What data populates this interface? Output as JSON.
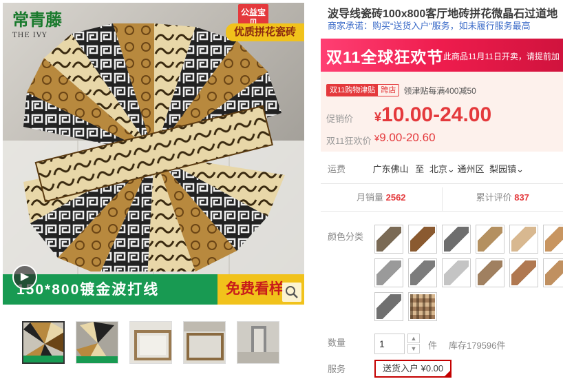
{
  "main_image": {
    "brand_cn": "常青藤",
    "brand_en": "THE IVY",
    "charity_badge": "公益宝贝",
    "top_slogan": "优质拼花瓷砖",
    "bottom_caption": "150*800镀金波打线",
    "free_sample": "免费看样",
    "play_icon": "play-icon",
    "zoom_icon": "zoom-icon"
  },
  "thumbnails": [
    {
      "name": "thumb-1",
      "active": true
    },
    {
      "name": "thumb-2",
      "active": false
    },
    {
      "name": "thumb-3",
      "active": false
    },
    {
      "name": "thumb-4",
      "active": false
    },
    {
      "name": "thumb-5",
      "active": false
    }
  ],
  "product": {
    "title": "波导线瓷砖100x800客厅地砖拼花微晶石过道地",
    "promise": "商家承诺：购买“送货入户”服务，如未履行服务最高"
  },
  "double11": {
    "banner_text": "双11全球狂欢节",
    "banner_note": "此商品11月11日开卖，请提前加",
    "coupon_tag_a": "双11购物津贴",
    "coupon_tag_b": "跨店",
    "coupon_text": "领津贴每满400减50"
  },
  "price": {
    "promo_label": "促销价",
    "currency": "¥",
    "promo_value": "10.00-24.00",
    "d11_label": "双11狂欢价",
    "d11_value": "9.00-20.60"
  },
  "shipping": {
    "label": "运费",
    "from": "广东佛山",
    "to_label": "至",
    "city": "北京",
    "district": "通州区",
    "town": "梨园镇"
  },
  "stats": {
    "monthly_label": "月销量",
    "monthly_value": "2562",
    "reviews_label": "累计评价",
    "reviews_value": "837"
  },
  "color_label": "颜色分类",
  "colors": [
    "#7a6a55",
    "#8a5a30",
    "#6e6e6e",
    "#b49060",
    "#d8b890",
    "#c89560",
    "#9a9a9a",
    "#7c7c7c",
    "#c4c4c4",
    "#a08060",
    "#b07850",
    "#c09060",
    "#707070",
    "#9a7560"
  ],
  "quantity": {
    "label": "数量",
    "value": "1",
    "unit": "件",
    "stock": "库存179596件"
  },
  "service": {
    "label": "服务",
    "option": "送货入户 ¥0.00"
  }
}
